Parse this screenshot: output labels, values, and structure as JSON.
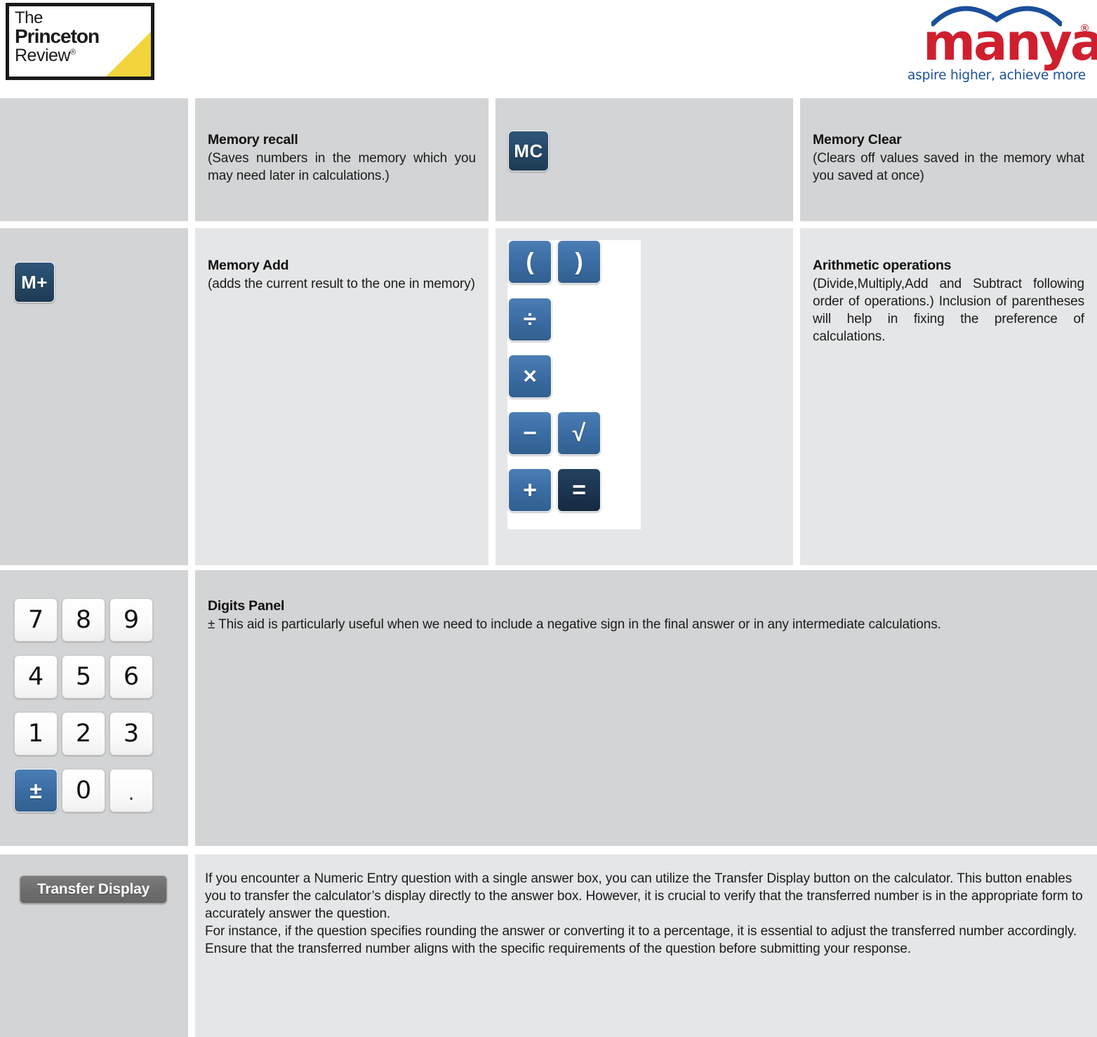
{
  "header": {
    "princeton_logo": {
      "line1": "The",
      "line2": "Princeton",
      "line3": "Review",
      "registered": "®"
    },
    "manya_logo": {
      "word": "manya",
      "registered": "®",
      "tagline": "aspire higher, achieve more",
      "brand_red": "#cf1f2e",
      "brand_blue": "#1b4f9c"
    }
  },
  "rows": [
    {
      "id": "memory-recall",
      "left_button": "",
      "title": "Memory recall",
      "desc": "(Saves numbers in the memory which you may need later in calculations.)",
      "icon_button": "MC",
      "right_title": "Memory Clear",
      "right_desc": "(Clears off values saved in the memory what you saved at once)"
    },
    {
      "id": "memory-add",
      "left_button": "M+",
      "title": "Memory Add",
      "desc": "(adds the current result to the one in memory)",
      "right_title": "Arithmetic operations",
      "right_desc": "(Divide,Multiply,Add and Subtract following order of operations.) Inclusion of parentheses will help in fixing the preference of calculations."
    },
    {
      "id": "digits-panel",
      "title": "Digits Panel",
      "desc": "± This aid is particularly useful when we need to include a negative sign in the final answer or in any intermediate calculations."
    },
    {
      "id": "transfer-display",
      "button_label": "Transfer Display",
      "paragraph1": "If you encounter a Numeric Entry question with a single answer box, you can utilize the Transfer Display button on the calculator. This button enables you to transfer the calculator’s display directly to the answer box. However, it is crucial to verify that the transferred number is in the appropriate form to accurately answer the question.",
      "paragraph2": "For instance, if the question specifies rounding the answer or converting it to a percentage, it is essential to adjust the transferred number accordingly. Ensure that the transferred number aligns with the specific requirements of the question before submitting your response."
    }
  ],
  "operations_keypad": {
    "keys": [
      {
        "label": "(",
        "name": "open-paren-button",
        "style": "blue"
      },
      {
        "label": ")",
        "name": "close-paren-button",
        "style": "blue"
      },
      {
        "label": "÷",
        "name": "divide-button",
        "style": "blue"
      },
      {
        "label": "×",
        "name": "multiply-button",
        "style": "blue"
      },
      {
        "label": "−",
        "name": "minus-button",
        "style": "blue"
      },
      {
        "label": "√",
        "name": "sqrt-button",
        "style": "blue"
      },
      {
        "label": "+",
        "name": "plus-button",
        "style": "blue"
      },
      {
        "label": "=",
        "name": "equals-button",
        "style": "dark"
      }
    ]
  },
  "digits_keypad": {
    "keys": [
      {
        "label": "7",
        "style": "white"
      },
      {
        "label": "8",
        "style": "white"
      },
      {
        "label": "9",
        "style": "white"
      },
      {
        "label": "4",
        "style": "white"
      },
      {
        "label": "5",
        "style": "white"
      },
      {
        "label": "6",
        "style": "white"
      },
      {
        "label": "1",
        "style": "white"
      },
      {
        "label": "2",
        "style": "white"
      },
      {
        "label": "3",
        "style": "white"
      },
      {
        "label": "±",
        "style": "blue"
      },
      {
        "label": "0",
        "style": "white"
      },
      {
        "label": ".",
        "style": "white"
      }
    ]
  },
  "colors": {
    "cell_gray_dark": "#d3d4d5",
    "cell_gray_light": "#e5e6e7",
    "button_blue": "#3a6ba2",
    "button_navy": "#1b3450",
    "transfer_gray": "#6e6e6e"
  }
}
